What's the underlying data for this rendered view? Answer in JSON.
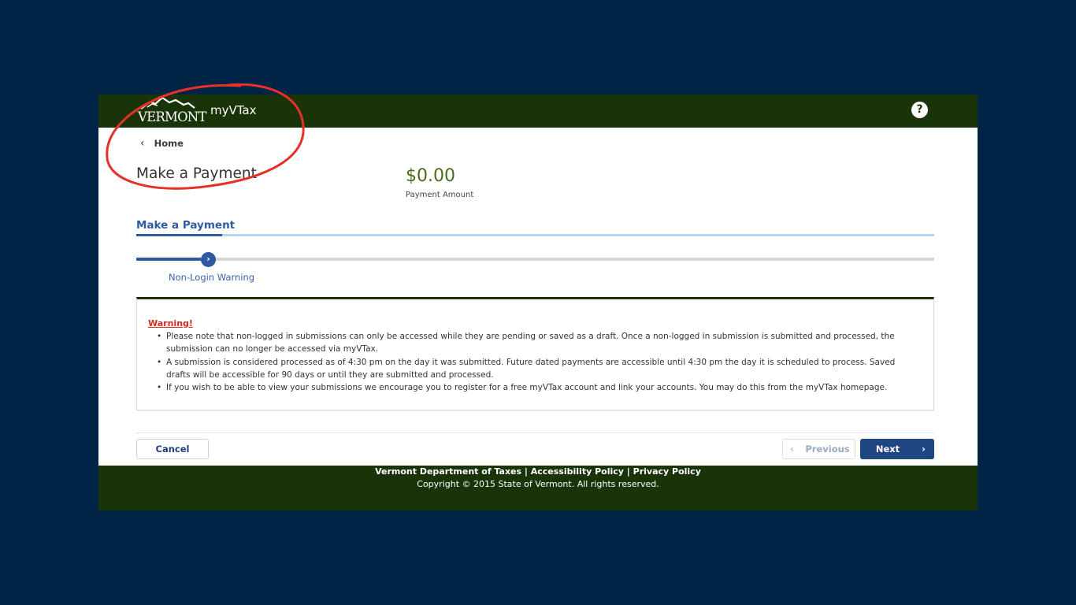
{
  "header": {
    "logo_text": "VERMONT",
    "app_name": "myVTax",
    "help_label": "?"
  },
  "nav": {
    "home_label": "Home"
  },
  "page": {
    "title": "Make a Payment",
    "amount": "$0.00",
    "amount_label": "Payment Amount"
  },
  "section_tab": "Make a Payment",
  "steps": [
    {
      "label": "Non-Login Warning",
      "active": true
    }
  ],
  "warning": {
    "title": "Warning!",
    "items": [
      "Please note that non-logged in submissions can only be accessed while they are pending or saved as a draft. Once a non-logged in submission is submitted and processed, the submission can no longer be accessed via myVTax.",
      "A submission is considered processed as of 4:30 pm on the day it was submitted. Future dated payments are accessible until 4:30 pm the day it is scheduled to process. Saved drafts will be accessible for 90 days or until they are submitted and processed.",
      "If you wish to be able to view your submissions we encourage you to register for a free myVTax account and link your accounts. You may do this from the myVTax homepage."
    ]
  },
  "buttons": {
    "cancel": "Cancel",
    "previous": "Previous",
    "next": "Next"
  },
  "footer": {
    "link_dept": "Vermont Department of Taxes",
    "link_accessibility": "Accessibility Policy",
    "link_privacy": "Privacy Policy",
    "separator": "|",
    "copyright": "Copyright © 2015 State of Vermont. All rights reserved."
  },
  "colors": {
    "page_background": "#002445",
    "header_green": "#1a3409",
    "accent_blue": "#2d5aa0",
    "amount_green": "#4a6b1d",
    "warning_red": "#d52b1e",
    "annotation_red": "#e8302a"
  },
  "icons": {
    "help": "question-circle-icon",
    "back": "chevron-left-icon",
    "step": "chevron-right-icon",
    "prev": "chevron-left-icon",
    "next": "chevron-right-icon"
  }
}
